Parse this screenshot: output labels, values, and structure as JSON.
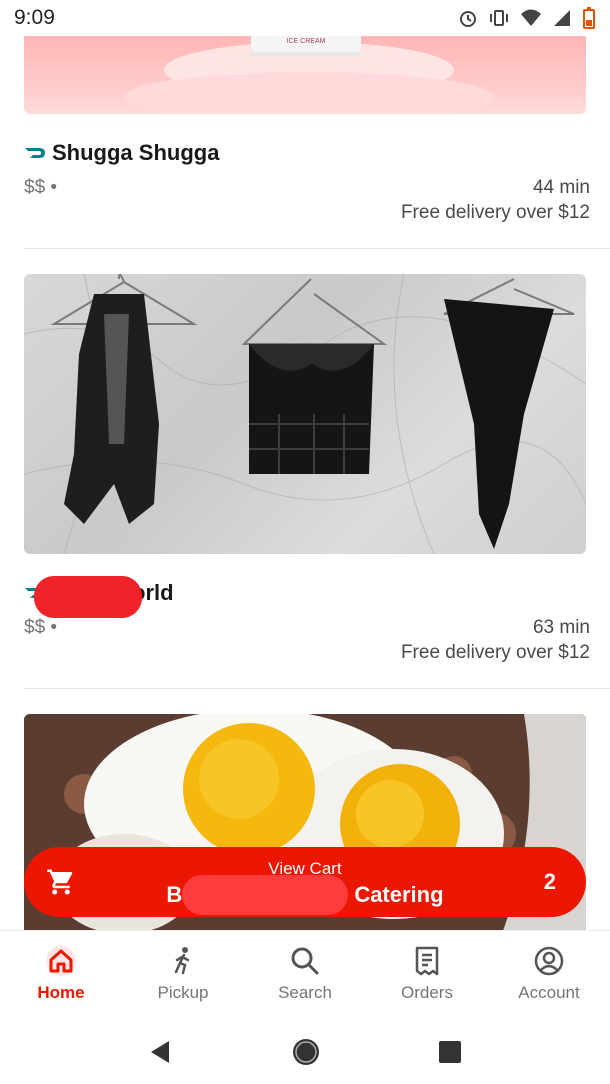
{
  "status_bar": {
    "time": "9:09"
  },
  "stores": [
    {
      "name": "Shugga Shugga",
      "price": "$$ •",
      "eta": "44 min",
      "fee": "Free delivery over $12"
    },
    {
      "name": "orld",
      "price": "$$ •",
      "eta": "63 min",
      "fee": "Free delivery over $12"
    }
  ],
  "banner_text": "ICE CREAM",
  "cart": {
    "label": "View Cart",
    "store_prefix": "B",
    "store_suffix": "Catering",
    "count": "2"
  },
  "tabs": [
    {
      "label": "Home",
      "icon": "home-icon",
      "active": true
    },
    {
      "label": "Pickup",
      "icon": "walking-icon"
    },
    {
      "label": "Search",
      "icon": "search-icon"
    },
    {
      "label": "Orders",
      "icon": "receipt-icon"
    },
    {
      "label": "Account",
      "icon": "account-icon"
    }
  ],
  "colors": {
    "brand": "#eb1700",
    "redaction": "#f0232b"
  }
}
